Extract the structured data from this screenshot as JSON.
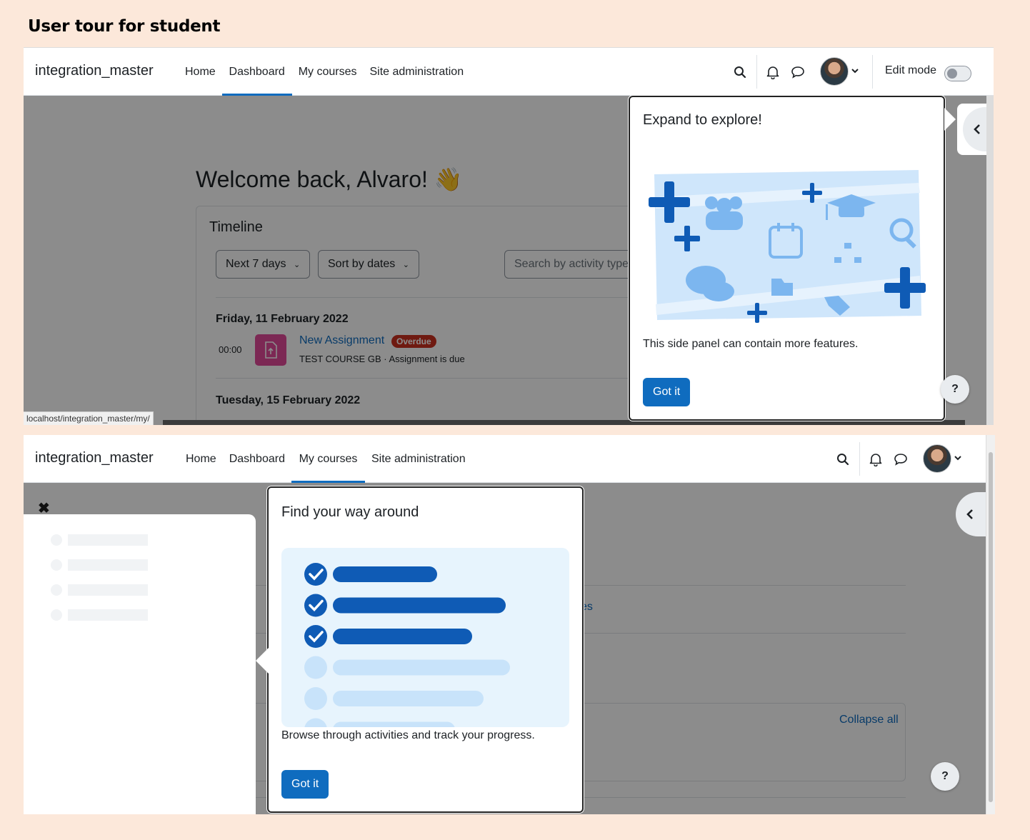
{
  "heading": "User tour for student",
  "shot1": {
    "navbar": {
      "brand": "integration_master",
      "links": [
        "Home",
        "Dashboard",
        "My courses",
        "Site administration"
      ],
      "active": "Dashboard",
      "edit_mode_label": "Edit mode",
      "icons": [
        "search-icon",
        "bell-icon",
        "chat-icon",
        "avatar",
        "chevron-down-icon"
      ]
    },
    "welcome": "Welcome back, Alvaro! 👋",
    "timeline": {
      "title": "Timeline",
      "filter_select": "Next 7 days",
      "sort_select": "Sort by dates",
      "search_placeholder": "Search by activity type",
      "groups": [
        {
          "date": "Friday, 11 February 2022",
          "time": "00:00",
          "activity": "New Assignment",
          "badge": "Overdue",
          "meta": "TEST COURSE GB · Assignment is due"
        },
        {
          "date": "Tuesday, 15 February 2022"
        }
      ]
    },
    "status_url": "localhost/integration_master/my/",
    "tour": {
      "title": "Expand to explore!",
      "body": "This side panel can contain more features.",
      "button": "Got it"
    },
    "help_label": "?"
  },
  "shot2": {
    "navbar": {
      "brand": "integration_master",
      "links": [
        "Home",
        "Dashboard",
        "My courses",
        "Site administration"
      ],
      "active": "My courses",
      "icons": [
        "search-icon",
        "bell-icon",
        "chat-icon",
        "avatar",
        "chevron-down-icon"
      ]
    },
    "partial_link_text": "es",
    "collapse_all": "Collapse all",
    "tour": {
      "title": "Find your way around",
      "body": "Browse through activities and track your progress.",
      "button": "Got it",
      "checklist": [
        {
          "done": true,
          "fill": 0.47
        },
        {
          "done": true,
          "fill": 0.78
        },
        {
          "done": true,
          "fill": 0.63
        },
        {
          "done": false,
          "fill": 0.8
        },
        {
          "done": false,
          "fill": 0.68
        },
        {
          "done": false,
          "fill": 0.55
        }
      ]
    },
    "help_label": "?"
  },
  "colors": {
    "background": "#fce8da",
    "primary": "#0f6cbf",
    "overdue": "#ca3120",
    "assignment": "#e24a99",
    "illustration_light": "#cfe6fb",
    "illustration_dark": "#0f5bb5"
  }
}
